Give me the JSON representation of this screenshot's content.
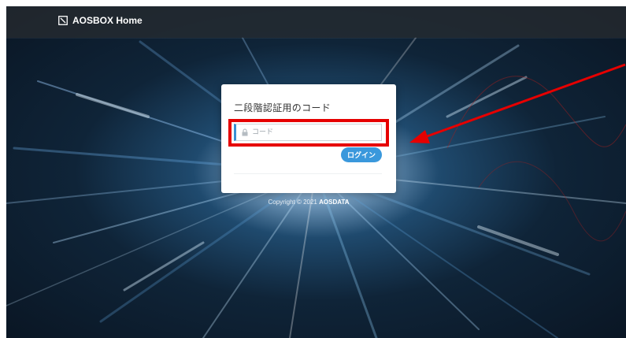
{
  "header": {
    "brand_label": "AOSBOX Home",
    "brand_icon": "external-link-square-icon"
  },
  "login_card": {
    "title": "二段階認証用のコード",
    "code_field": {
      "placeholder": "コード",
      "value": "",
      "icon": "lock-icon"
    },
    "login_button_label": "ログイン"
  },
  "footer": {
    "copyright_prefix": "Copyright © 2021 ",
    "copyright_company": "AOSDATA"
  },
  "annotations": {
    "highlight_color": "#e60000",
    "arrow_color": "#e60000"
  },
  "colors": {
    "accent": "#3a98dc",
    "header_bg": "#282c30"
  }
}
